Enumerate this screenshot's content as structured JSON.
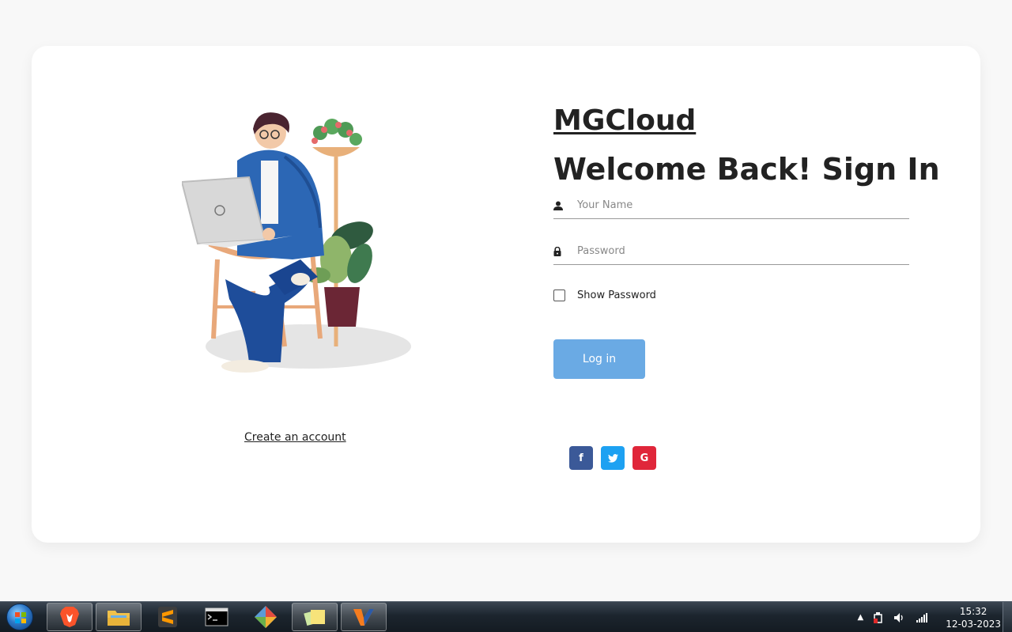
{
  "app": {
    "brand": "MGCloud",
    "heading": "Welcome Back! Sign In"
  },
  "form": {
    "name_placeholder": "Your Name",
    "password_placeholder": "Password",
    "show_password_label": "Show Password",
    "login_label": "Log in"
  },
  "links": {
    "create_account": "Create an account"
  },
  "social": {
    "facebook_glyph": "f",
    "google_glyph": "G"
  },
  "taskbar": {
    "time": "15:32",
    "date": "12-03-2023"
  },
  "colors": {
    "login_button": "#6aaae4",
    "facebook": "#3b5998",
    "twitter": "#1da1f2",
    "google": "#e0263a"
  }
}
